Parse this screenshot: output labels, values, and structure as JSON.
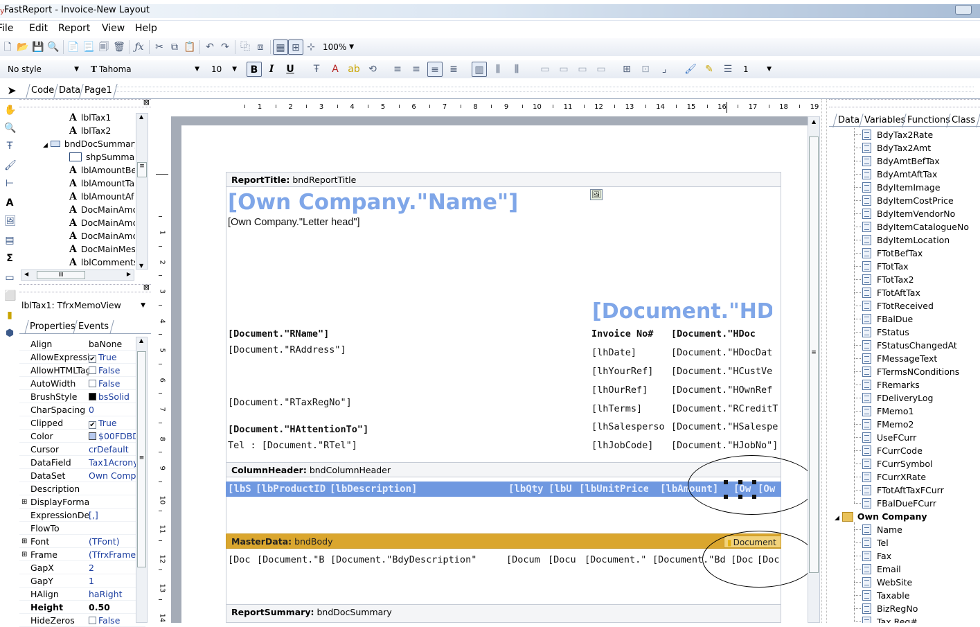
{
  "window": {
    "title": "FastReport - Invoice-New Layout"
  },
  "menu": [
    "File",
    "Edit",
    "Report",
    "View",
    "Help"
  ],
  "toolbar": {
    "zoom": "100%",
    "style": "No style",
    "font": "Tahoma",
    "font_size": "10",
    "line_width": "1",
    "bold": "B",
    "italic": "I",
    "underline": "U"
  },
  "designer_tabs": [
    "Code",
    "Data",
    "Page1"
  ],
  "tree": {
    "items": [
      "lblTax1",
      "lblTax2",
      "bndDocSummary",
      "shpSummary",
      "lblAmountBe",
      "lblAmountTa",
      "lblAmountAf",
      "DocMainAmc",
      "DocMainAmc",
      "DocMainAmc",
      "DocMainMes",
      "lblComments"
    ],
    "hscroll_label": "III"
  },
  "object_selector": "lblTax1: TfrxMemoView",
  "inspector_tabs": [
    "Properties",
    "Events"
  ],
  "properties": [
    {
      "name": "Align",
      "value": "baNone",
      "kind": "combo"
    },
    {
      "name": "AllowExpressio",
      "value": "True",
      "kind": "check",
      "checked": true
    },
    {
      "name": "AllowHTMLTag",
      "value": "False",
      "kind": "check",
      "checked": false
    },
    {
      "name": "AutoWidth",
      "value": "False",
      "kind": "check",
      "checked": false
    },
    {
      "name": "BrushStyle",
      "value": "bsSolid",
      "kind": "swatch",
      "color": "#000000"
    },
    {
      "name": "CharSpacing",
      "value": "0",
      "kind": "text"
    },
    {
      "name": "Clipped",
      "value": "True",
      "kind": "check",
      "checked": true
    },
    {
      "name": "Color",
      "value": "$00FDBD",
      "kind": "swatch",
      "color": "#b7c9ee"
    },
    {
      "name": "Cursor",
      "value": "crDefault",
      "kind": "text"
    },
    {
      "name": "DataField",
      "value": "Tax1Acrony",
      "kind": "text"
    },
    {
      "name": "DataSet",
      "value": "Own Compa",
      "kind": "text"
    },
    {
      "name": "Description",
      "value": "",
      "kind": "text"
    },
    {
      "name": "DisplayFormat",
      "value": "",
      "kind": "expand"
    },
    {
      "name": "ExpressionDeli",
      "value": "[,]",
      "kind": "text"
    },
    {
      "name": "FlowTo",
      "value": "",
      "kind": "text"
    },
    {
      "name": "Font",
      "value": "(TFont)",
      "kind": "expand"
    },
    {
      "name": "Frame",
      "value": "(TfrxFrame)",
      "kind": "expand"
    },
    {
      "name": "GapX",
      "value": "2",
      "kind": "text"
    },
    {
      "name": "GapY",
      "value": "1",
      "kind": "text"
    },
    {
      "name": "HAlign",
      "value": "haRight",
      "kind": "text"
    },
    {
      "name": "Height",
      "value": "0.50",
      "kind": "bold"
    },
    {
      "name": "HideZeros",
      "value": "False",
      "kind": "check",
      "checked": false
    }
  ],
  "ruler": {
    "h": [
      "1",
      "2",
      "3",
      "4",
      "5",
      "6",
      "7",
      "8",
      "9",
      "10",
      "11",
      "12",
      "13",
      "14",
      "15",
      "16",
      "17",
      "18",
      "19"
    ],
    "v": [
      "1",
      "2",
      "3",
      "4",
      "5",
      "6",
      "7",
      "8",
      "9",
      "10",
      "11",
      "12",
      "13",
      "14"
    ]
  },
  "report": {
    "title_band": {
      "label": "ReportTitle:",
      "name": "bndReportTitle"
    },
    "company_name": "[Own Company.\"Name\"]",
    "letter_head": "[Own Company.\"Letter head\"]",
    "doc_heading": "[Document.\"HD",
    "left_fields": [
      "[Document.\"RName\"]",
      "[Document.\"RAddress\"]",
      "[Document.\"RTaxRegNo\"]",
      "[Document.\"HAttentionTo\"]",
      "Tel : [Document.\"RTel\"]"
    ],
    "label_fields": [
      "Invoice No#",
      "[lhDate]",
      "[lhYourRef]",
      "[lhOurRef]",
      "[lhTerms]",
      "[lhSalesperson]",
      "[lhJobCode]"
    ],
    "value_fields": [
      "[Document.\"HDoc",
      "[Document.\"HDocDat",
      "[Document.\"HCustVe",
      "[Document.\"HOwnRef",
      "[Document.\"RCreditT",
      "[Document.\"HSalespe",
      "[Document.\"HJobNo\"]"
    ],
    "column_band": {
      "label": "ColumnHeader:",
      "name": "bndColumnHeader"
    },
    "columns": [
      "[lbS",
      "[lbProductID",
      "[lbDescription]",
      "[lbQty",
      "[lbU",
      "[lbUnitPrice",
      "[lbAmount]",
      "[Ow",
      "[Ow"
    ],
    "master_band": {
      "label": "MasterData:",
      "name": "bndBody",
      "dataset": "Document"
    },
    "master_fields": [
      "[Doc",
      "[Document.\"B",
      "[Document.\"BdyDescription\"]",
      "[Docum",
      "[Docu",
      "[Document.\"",
      "[Document.\"Bd",
      "[Doc",
      "[Doc"
    ],
    "summary_band": {
      "label": "ReportSummary:",
      "name": "bndDocSummary"
    }
  },
  "right_tabs": [
    "Data",
    "Variables",
    "Functions",
    "Class"
  ],
  "data_tree": {
    "document_fields": [
      "BdyTax2Rate",
      "BdyTax2Amt",
      "BdyAmtBefTax",
      "BdyAmtAftTax",
      "BdyItemImage",
      "BdyItemCostPrice",
      "BdyItemVendorNo",
      "BdyItemCatalogueNo",
      "BdyItemLocation",
      "FTotBefTax",
      "FTotTax",
      "FTotTax2",
      "FTotAftTax",
      "FTotReceived",
      "FBalDue",
      "FStatus",
      "FStatusChangedAt",
      "FMessageText",
      "FTermsNConditions",
      "FRemarks",
      "FDeliveryLog",
      "FMemo1",
      "FMemo2",
      "UseFCurr",
      "FCurrCode",
      "FCurrSymbol",
      "FCurrXRate",
      "FTotAftTaxFCurr",
      "FBalDueFCurr"
    ],
    "own_company": "Own Company",
    "own_company_fields": [
      "Name",
      "Tel",
      "Fax",
      "Email",
      "WebSite",
      "Taxable",
      "BizRegNo",
      "Tax Reg#"
    ]
  }
}
